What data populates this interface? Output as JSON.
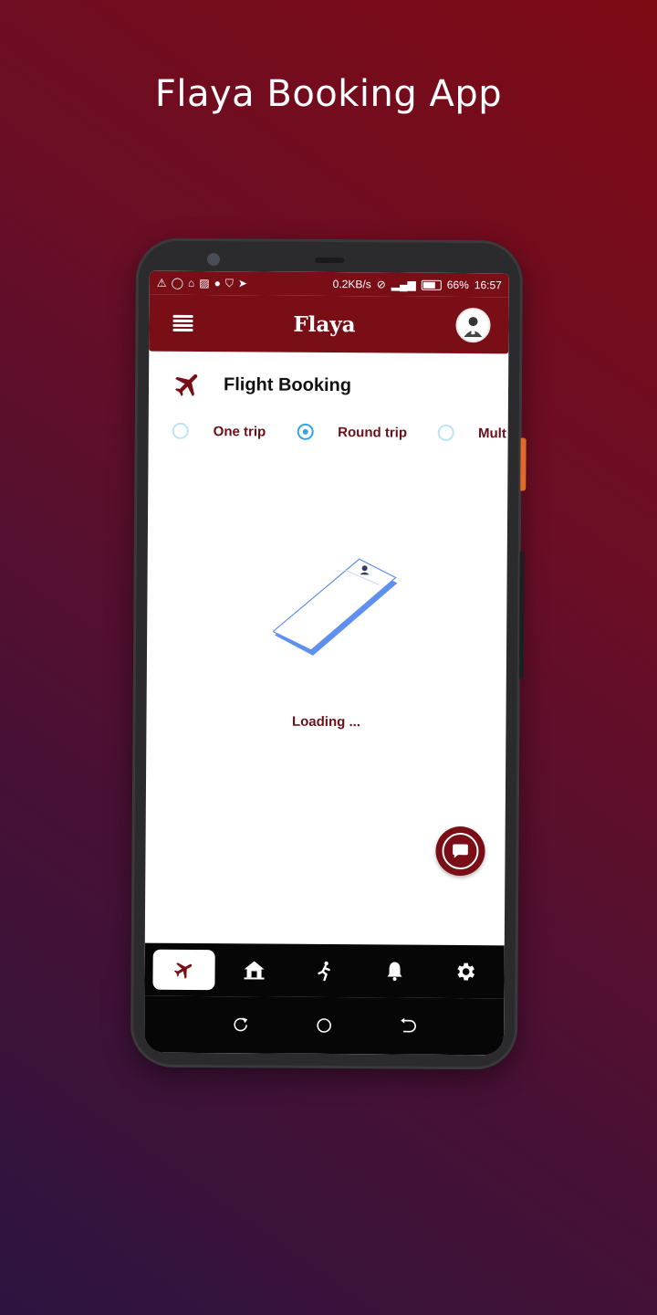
{
  "promo": {
    "title": "Flaya Booking App"
  },
  "status_bar": {
    "network_speed": "0.2KB/s",
    "battery": "66%",
    "time": "16:57"
  },
  "app_bar": {
    "title": "Flaya"
  },
  "section": {
    "title": "Flight Booking"
  },
  "trip_options": [
    {
      "label": "One trip",
      "selected": false
    },
    {
      "label": "Round trip",
      "selected": true
    },
    {
      "label": "Mult",
      "selected": false
    }
  ],
  "loading": {
    "text": "Loading ..."
  },
  "bottom_nav": [
    "plane-icon",
    "home-icon",
    "running-icon",
    "bell-icon",
    "gear-icon"
  ],
  "colors": {
    "brand": "#7a0e16",
    "radio_accent": "#34a4e6",
    "label": "#6b0f19"
  }
}
